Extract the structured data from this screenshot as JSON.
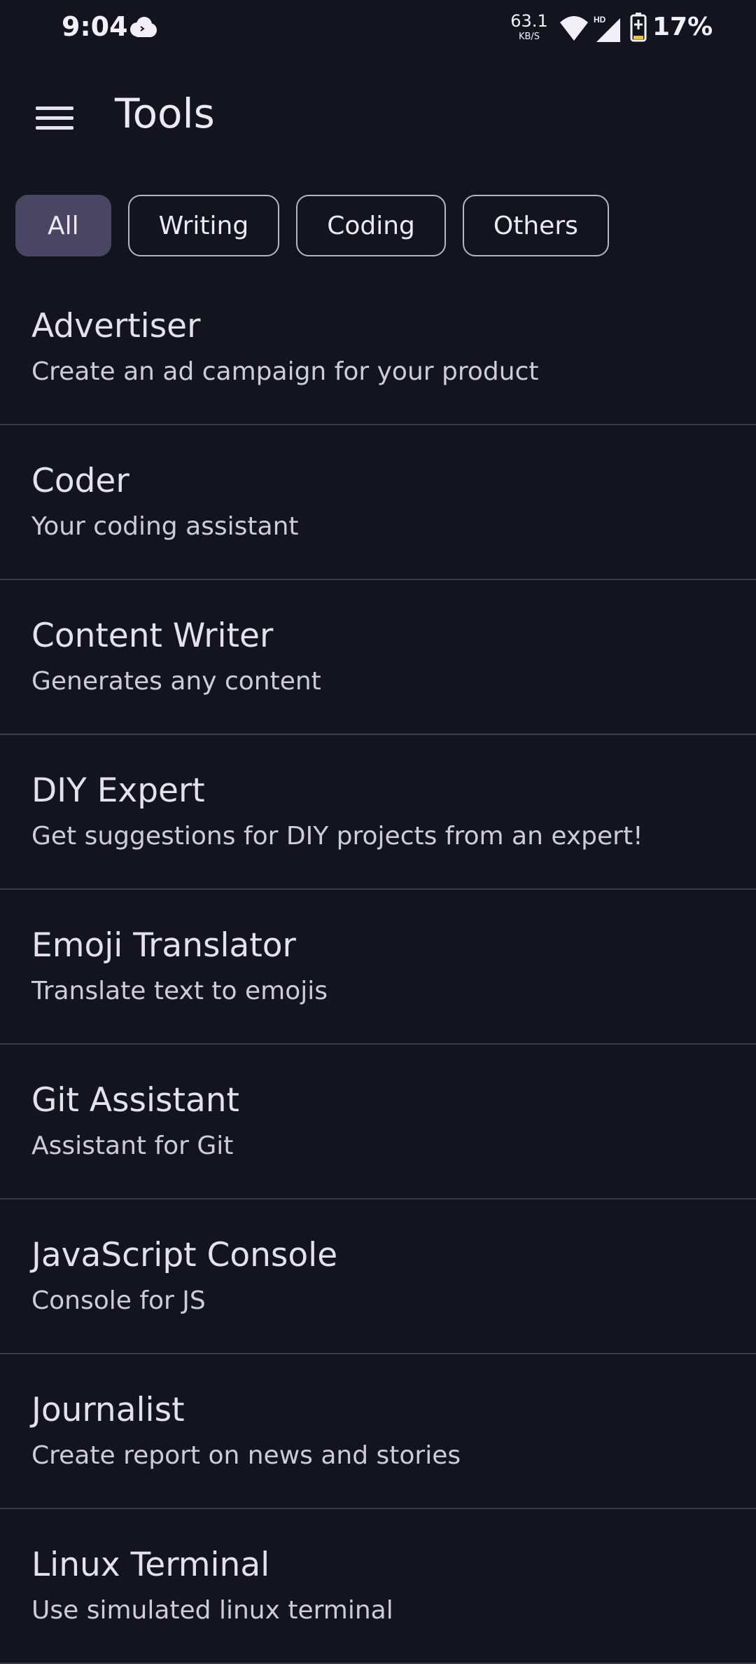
{
  "status_bar": {
    "time": "9:04",
    "net_speed_value": "63.1",
    "net_speed_unit": "KB/S",
    "network_badge": "HD",
    "battery": "17%"
  },
  "app_bar": {
    "title": "Tools",
    "menu_icon": "hamburger-menu-icon"
  },
  "filters": [
    {
      "label": "All",
      "selected": true
    },
    {
      "label": "Writing",
      "selected": false
    },
    {
      "label": "Coding",
      "selected": false
    },
    {
      "label": "Others",
      "selected": false
    }
  ],
  "tools": [
    {
      "name": "Advertiser",
      "description": "Create an ad campaign for your product"
    },
    {
      "name": "Coder",
      "description": "Your coding assistant"
    },
    {
      "name": "Content Writer",
      "description": "Generates any content"
    },
    {
      "name": "DIY Expert",
      "description": "Get suggestions for DIY projects from an expert!"
    },
    {
      "name": "Emoji Translator",
      "description": "Translate text to emojis"
    },
    {
      "name": "Git Assistant",
      "description": "Assistant for Git"
    },
    {
      "name": "JavaScript Console",
      "description": "Console for JS"
    },
    {
      "name": "Journalist",
      "description": "Create report on news and stories"
    },
    {
      "name": "Linux Terminal",
      "description": "Use simulated linux terminal"
    }
  ],
  "colors": {
    "background": "#141420",
    "selected_chip": "#4a4563",
    "divider": "#3a3944",
    "text": "#e4e1eb"
  }
}
